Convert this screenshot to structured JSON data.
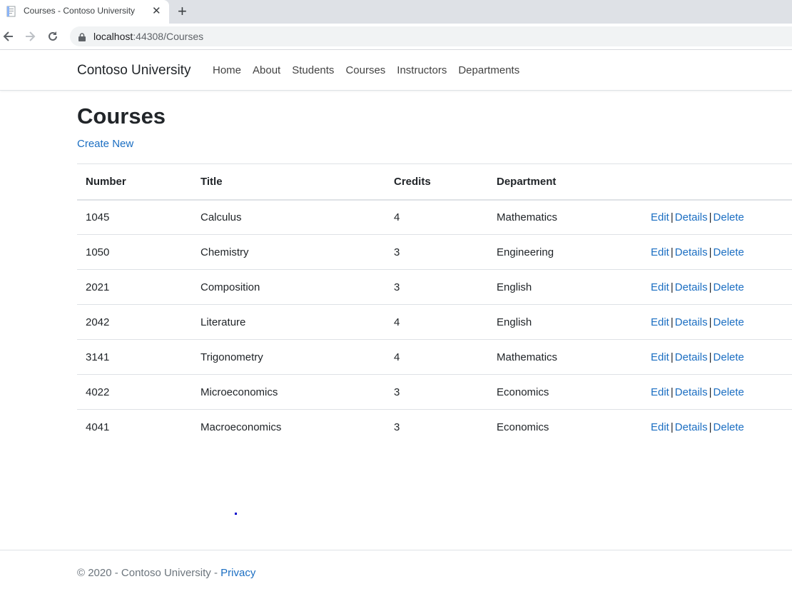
{
  "browser": {
    "tab_title": "Courses - Contoso University",
    "url_host": "localhost",
    "url_rest": ":44308/Courses"
  },
  "site": {
    "brand": "Contoso University",
    "nav": [
      "Home",
      "About",
      "Students",
      "Courses",
      "Instructors",
      "Departments"
    ]
  },
  "main": {
    "title": "Courses",
    "create_new": "Create New",
    "columns": [
      "Number",
      "Title",
      "Credits",
      "Department"
    ],
    "rows": [
      {
        "number": "1045",
        "title": "Calculus",
        "credits": "4",
        "department": "Mathematics"
      },
      {
        "number": "1050",
        "title": "Chemistry",
        "credits": "3",
        "department": "Engineering"
      },
      {
        "number": "2021",
        "title": "Composition",
        "credits": "3",
        "department": "English"
      },
      {
        "number": "2042",
        "title": "Literature",
        "credits": "4",
        "department": "English"
      },
      {
        "number": "3141",
        "title": "Trigonometry",
        "credits": "4",
        "department": "Mathematics"
      },
      {
        "number": "4022",
        "title": "Microeconomics",
        "credits": "3",
        "department": "Economics"
      },
      {
        "number": "4041",
        "title": "Macroeconomics",
        "credits": "3",
        "department": "Economics"
      }
    ],
    "actions": {
      "edit": "Edit",
      "details": "Details",
      "delete": "Delete",
      "separator": "|"
    }
  },
  "footer": {
    "text": "© 2020 - Contoso University - ",
    "privacy": "Privacy"
  },
  "colors": {
    "link": "#1b6ec2",
    "text": "#212529",
    "muted": "#6c757d"
  }
}
